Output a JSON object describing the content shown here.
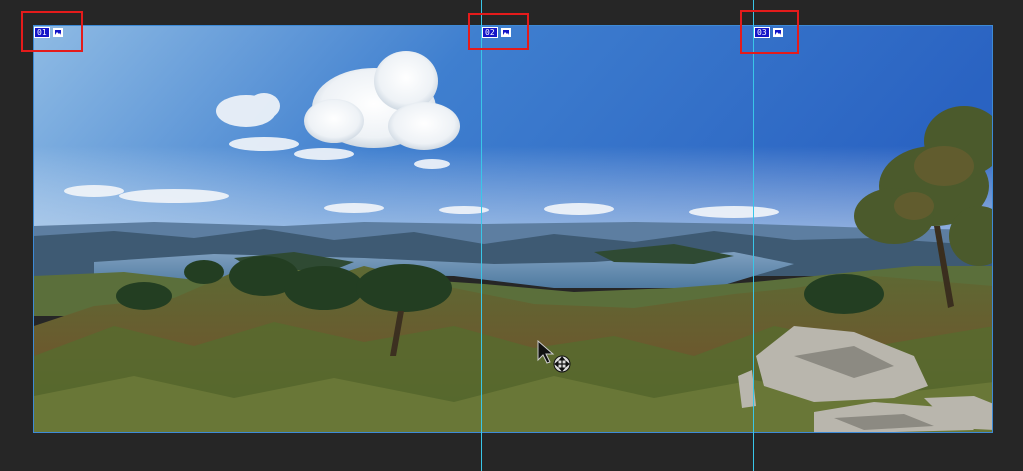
{
  "slices": [
    {
      "number": "01"
    },
    {
      "number": "02"
    },
    {
      "number": "03"
    }
  ],
  "colors": {
    "background": "#262626",
    "guide": "#39c6e8",
    "canvas_border": "#3d8ad6",
    "highlight": "#e41b1b",
    "slice_badge": "#1414c8"
  },
  "icons": {
    "slice_image": "image-icon",
    "cursor": "move-cursor-icon"
  }
}
